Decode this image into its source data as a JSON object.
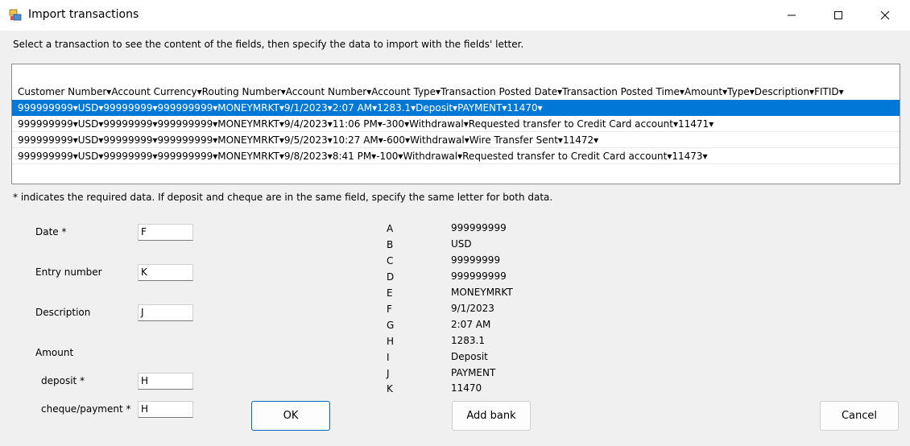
{
  "window": {
    "title": "Import transactions",
    "icon": "app-icon",
    "controls": [
      "minimize-icon",
      "maximize-icon",
      "close-icon"
    ]
  },
  "instructions": "Select a transaction to see the content of the fields, then specify the data to import with the fields' letter.",
  "list": {
    "header": "Customer Number▾Account Currency▾Routing Number▾Account Number▾Account Type▾Transaction Posted Date▾Transaction Posted Time▾Amount▾Type▾Description▾FITID▾",
    "rows": [
      "999999999▾USD▾99999999▾999999999▾MONEYMRKT▾9/1/2023▾2:07 AM▾1283.1▾Deposit▾PAYMENT▾11470▾",
      "999999999▾USD▾99999999▾999999999▾MONEYMRKT▾9/4/2023▾11:06 PM▾-300▾Withdrawal▾Requested transfer to Credit Card account▾11471▾",
      "999999999▾USD▾99999999▾999999999▾MONEYMRKT▾9/5/2023▾10:27 AM▾-600▾Withdrawal▾Wire Transfer Sent▾11472▾",
      "999999999▾USD▾99999999▾999999999▾MONEYMRKT▾9/8/2023▾8:41 PM▾-100▾Withdrawal▾Requested transfer to Credit Card account▾11473▾"
    ],
    "selected_index": 0
  },
  "required_note": "* indicates the required data. If deposit and cheque are in the same field, specify the same letter for both data.",
  "fields": {
    "date": {
      "label": "Date *",
      "value": "F"
    },
    "entry_number": {
      "label": "Entry number",
      "value": "K"
    },
    "description": {
      "label": "Description",
      "value": "J"
    },
    "amount": {
      "label": "Amount"
    },
    "deposit": {
      "label": "deposit *",
      "value": "H"
    },
    "cheque": {
      "label": "cheque/payment *",
      "value": "H"
    }
  },
  "field_letters": [
    {
      "letter": "A",
      "value": "999999999"
    },
    {
      "letter": "B",
      "value": "USD"
    },
    {
      "letter": "C",
      "value": "99999999"
    },
    {
      "letter": "D",
      "value": "999999999"
    },
    {
      "letter": "E",
      "value": "MONEYMRKT"
    },
    {
      "letter": "F",
      "value": "9/1/2023"
    },
    {
      "letter": "G",
      "value": "2:07 AM"
    },
    {
      "letter": "H",
      "value": "1283.1"
    },
    {
      "letter": "I",
      "value": "Deposit"
    },
    {
      "letter": "J",
      "value": "PAYMENT"
    },
    {
      "letter": "K",
      "value": "11470"
    }
  ],
  "buttons": {
    "ok": "OK",
    "add_bank": "Add bank",
    "cancel": "Cancel"
  },
  "colors": {
    "selection": "#0078d7",
    "default_button_border": "#0067c0"
  }
}
